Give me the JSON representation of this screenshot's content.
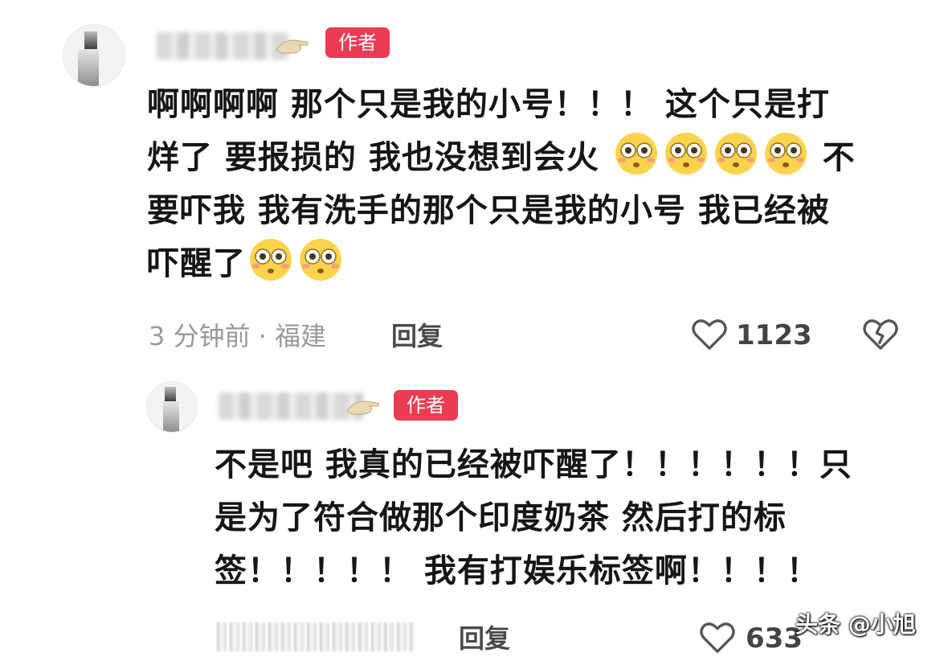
{
  "comment1": {
    "badge": "作者",
    "line1": "啊啊啊啊 那个只是我的小号！！！ 这个只是打",
    "line2a": "烊了 要报损的 我也没想到会火",
    "line2b": "不",
    "line3": "要吓我 我有洗手的那个只是我的小号 我已经被",
    "line4": "吓醒了",
    "meta": "3 分钟前 · 福建",
    "reply": "回复",
    "likes": "1123"
  },
  "comment2": {
    "badge": "作者",
    "line1": "不是吧 我真的已经被吓醒了！！！！！！只",
    "line2": "是为了符合做那个印度奶茶 然后打的标",
    "line3": "签！！！！！ 我有打娱乐标签啊！！！！",
    "reply": "回复",
    "likes": "633"
  },
  "watermark": {
    "text": "头条 @小旭"
  },
  "icons": {
    "like": "heart-outline-icon",
    "dislike": "broken-heart-icon",
    "emoji": "flushed-face-emoji-icon"
  },
  "colors": {
    "badge": "#ea3c53",
    "meta": "#9a9a9a",
    "text": "#161616"
  }
}
